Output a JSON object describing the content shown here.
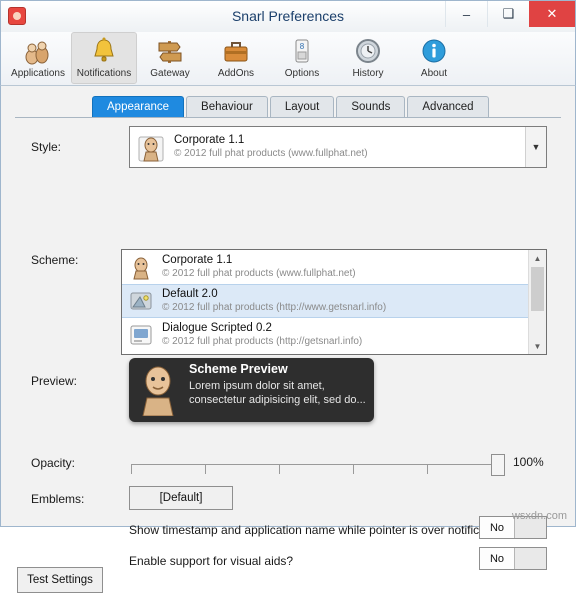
{
  "window": {
    "title": "Snarl Preferences",
    "icon": "snarl-app-icon",
    "buttons": {
      "minimize": "–",
      "maximize": "❑",
      "close": "✕"
    }
  },
  "toolbar": {
    "items": [
      {
        "label": "Applications",
        "icon": "applications-icon",
        "active": false
      },
      {
        "label": "Notifications",
        "icon": "bell-icon",
        "active": true
      },
      {
        "label": "Gateway",
        "icon": "signpost-icon",
        "active": false
      },
      {
        "label": "AddOns",
        "icon": "toolbox-icon",
        "active": false
      },
      {
        "label": "Options",
        "icon": "switch-icon",
        "active": false
      },
      {
        "label": "History",
        "icon": "clock-icon",
        "active": false
      },
      {
        "label": "About",
        "icon": "info-icon",
        "active": false
      }
    ]
  },
  "tabs": [
    {
      "label": "Appearance",
      "active": true
    },
    {
      "label": "Behaviour",
      "active": false
    },
    {
      "label": "Layout",
      "active": false
    },
    {
      "label": "Sounds",
      "active": false
    },
    {
      "label": "Advanced",
      "active": false
    }
  ],
  "form": {
    "style_label": "Style:",
    "scheme_label": "Scheme:",
    "preview_label": "Preview:",
    "opacity_label": "Opacity:",
    "emblems_label": "Emblems:",
    "style_value": {
      "name": "Corporate 1.1",
      "detail": "© 2012 full phat products (www.fullphat.net)"
    },
    "scheme_value": {
      "name": "Corporate 1.1",
      "detail": "© 2012 full phat products (www.fullphat.net)"
    },
    "dropdown_open": true,
    "dropdown_items": [
      {
        "name": "Corporate 1.1",
        "detail": "© 2012 full phat products (www.fullphat.net)",
        "selected": false
      },
      {
        "name": "Default 2.0",
        "detail": "© 2012 full phat products (http://www.getsnarl.info)",
        "selected": true
      },
      {
        "name": "Dialogue Scripted 0.2",
        "detail": "© 2012 full phat products (http://getsnarl.info)",
        "selected": false
      }
    ],
    "preview": {
      "title": "Scheme Preview",
      "body": "Lorem ipsum dolor sit amet, consectetur adipisicing elit, sed do..."
    },
    "opacity_value": "100%",
    "opacity_percent": 100,
    "emblems_button": "[Default]",
    "question_timestamp": "Show timestamp and application name while pointer is over notification?",
    "question_visual_aids": "Enable support for visual aids?",
    "toggle_timestamp": "No",
    "toggle_visual_aids": "No"
  },
  "footer": {
    "test_settings": "Test Settings",
    "watermark": "wsxdn.com"
  }
}
